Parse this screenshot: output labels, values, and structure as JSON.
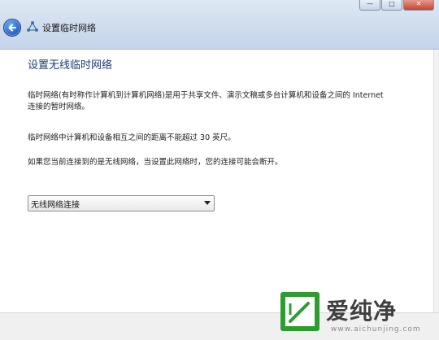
{
  "window": {
    "title": "设置临时网络",
    "controls": {
      "minimize": "—",
      "maximize": "□",
      "close": "✕"
    }
  },
  "content": {
    "heading": "设置无线临时网络",
    "paragraph1": "临时网络(有时称作计算机到计算机网络)是用于共享文件、演示文稿或多台计算机和设备之间的 Internet 连接的暂时网络。",
    "paragraph2": "临时网络中计算机和设备相互之间的距离不能超过 30 英尺。",
    "paragraph3": "如果您当前连接到的是无线网络，当设置此网络时，您的连接可能会断开。",
    "connection_select": {
      "selected": "无线网络连接"
    }
  },
  "watermark": {
    "text": "爱纯净",
    "url": "www.aichunjing.com",
    "colors": {
      "logo_green": "#2e9d2f",
      "text": "#3f3f3f"
    }
  },
  "colors": {
    "heading": "#1d3f73",
    "titlebar": "#d4e1f0"
  }
}
